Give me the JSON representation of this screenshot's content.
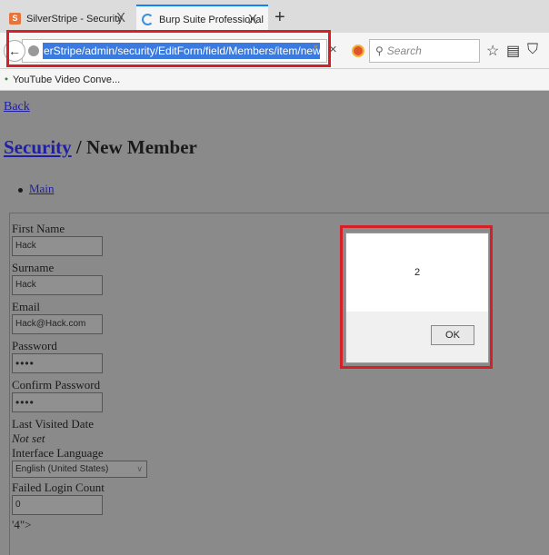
{
  "browser": {
    "tabs": [
      {
        "title": "SilverStripe - Security",
        "active": false
      },
      {
        "title": "Burp Suite Professional",
        "active": true
      }
    ],
    "tab_close": "X",
    "new_tab": "+",
    "url": "erStripe/admin/security/EditForm/field/Members/item/new/ItemEditForm",
    "url_clear": "×",
    "search_placeholder": "Search",
    "bookmark": "YouTube Video Conve..."
  },
  "page": {
    "back_link": "Back",
    "title_link": "Security",
    "title_rest": " / New Member",
    "nav_item": "Main"
  },
  "form": {
    "first_name_label": "First Name",
    "first_name_value": "Hack",
    "surname_label": "Surname",
    "surname_value": "Hack",
    "email_label": "Email",
    "email_value": "Hack@Hack.com",
    "password_label": "Password",
    "password_value": "••••",
    "confirm_password_label": "Confirm Password",
    "confirm_password_value": "••••",
    "last_visited_label": "Last Visited Date",
    "last_visited_value": "Not set",
    "language_label": "Interface Language",
    "language_value": "English (United States)",
    "failed_login_label": "Failed Login Count",
    "failed_login_value": "0",
    "tail_text": "'4\">"
  },
  "dialog": {
    "message": "2",
    "ok_label": "OK"
  },
  "icons": {
    "back": "back-arrow-icon",
    "shield": "shield-icon",
    "search": "search-icon",
    "star": "star-icon",
    "reader": "reader-icon",
    "pocket": "pocket-icon"
  }
}
